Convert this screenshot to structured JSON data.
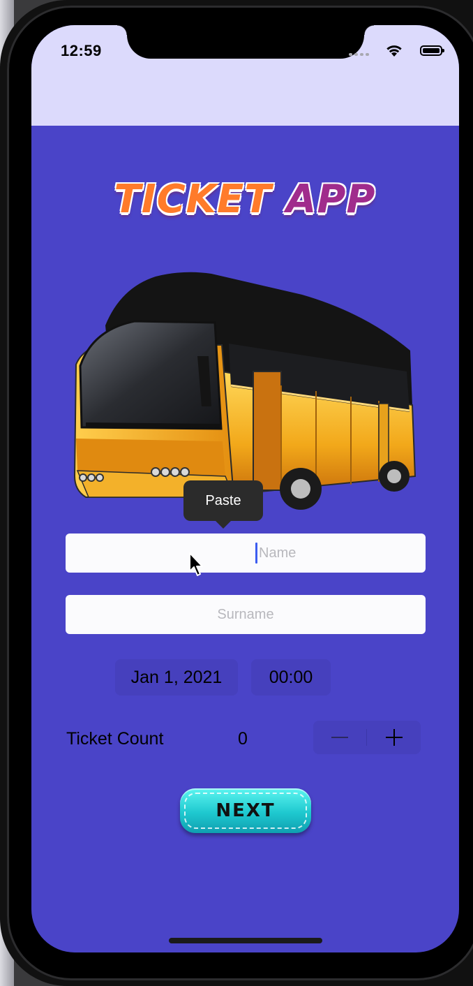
{
  "status_bar": {
    "time": "12:59",
    "icons": [
      "signal-dots-icon",
      "wifi-icon",
      "battery-icon"
    ]
  },
  "app": {
    "logo": {
      "part1": "TICKET",
      "part2": "APP",
      "colors": {
        "ticket": "#ff7b2a",
        "app": "#a02c8c"
      }
    },
    "hero_image": "bus-image",
    "background_color": "#4a44c8",
    "status_background_color": "#dcdafc"
  },
  "edit_menu": {
    "paste_label": "Paste"
  },
  "form": {
    "name_placeholder": "Name",
    "surname_placeholder": "Surname",
    "date_value": "Jan 1, 2021",
    "time_value": "00:00",
    "ticket_count_label": "Ticket Count",
    "ticket_count_value": "0",
    "stepper": {
      "minus_icon": "minus-icon",
      "plus_icon": "plus-icon"
    },
    "next_label": "NEXT",
    "next_color": "#1ec8cf"
  }
}
